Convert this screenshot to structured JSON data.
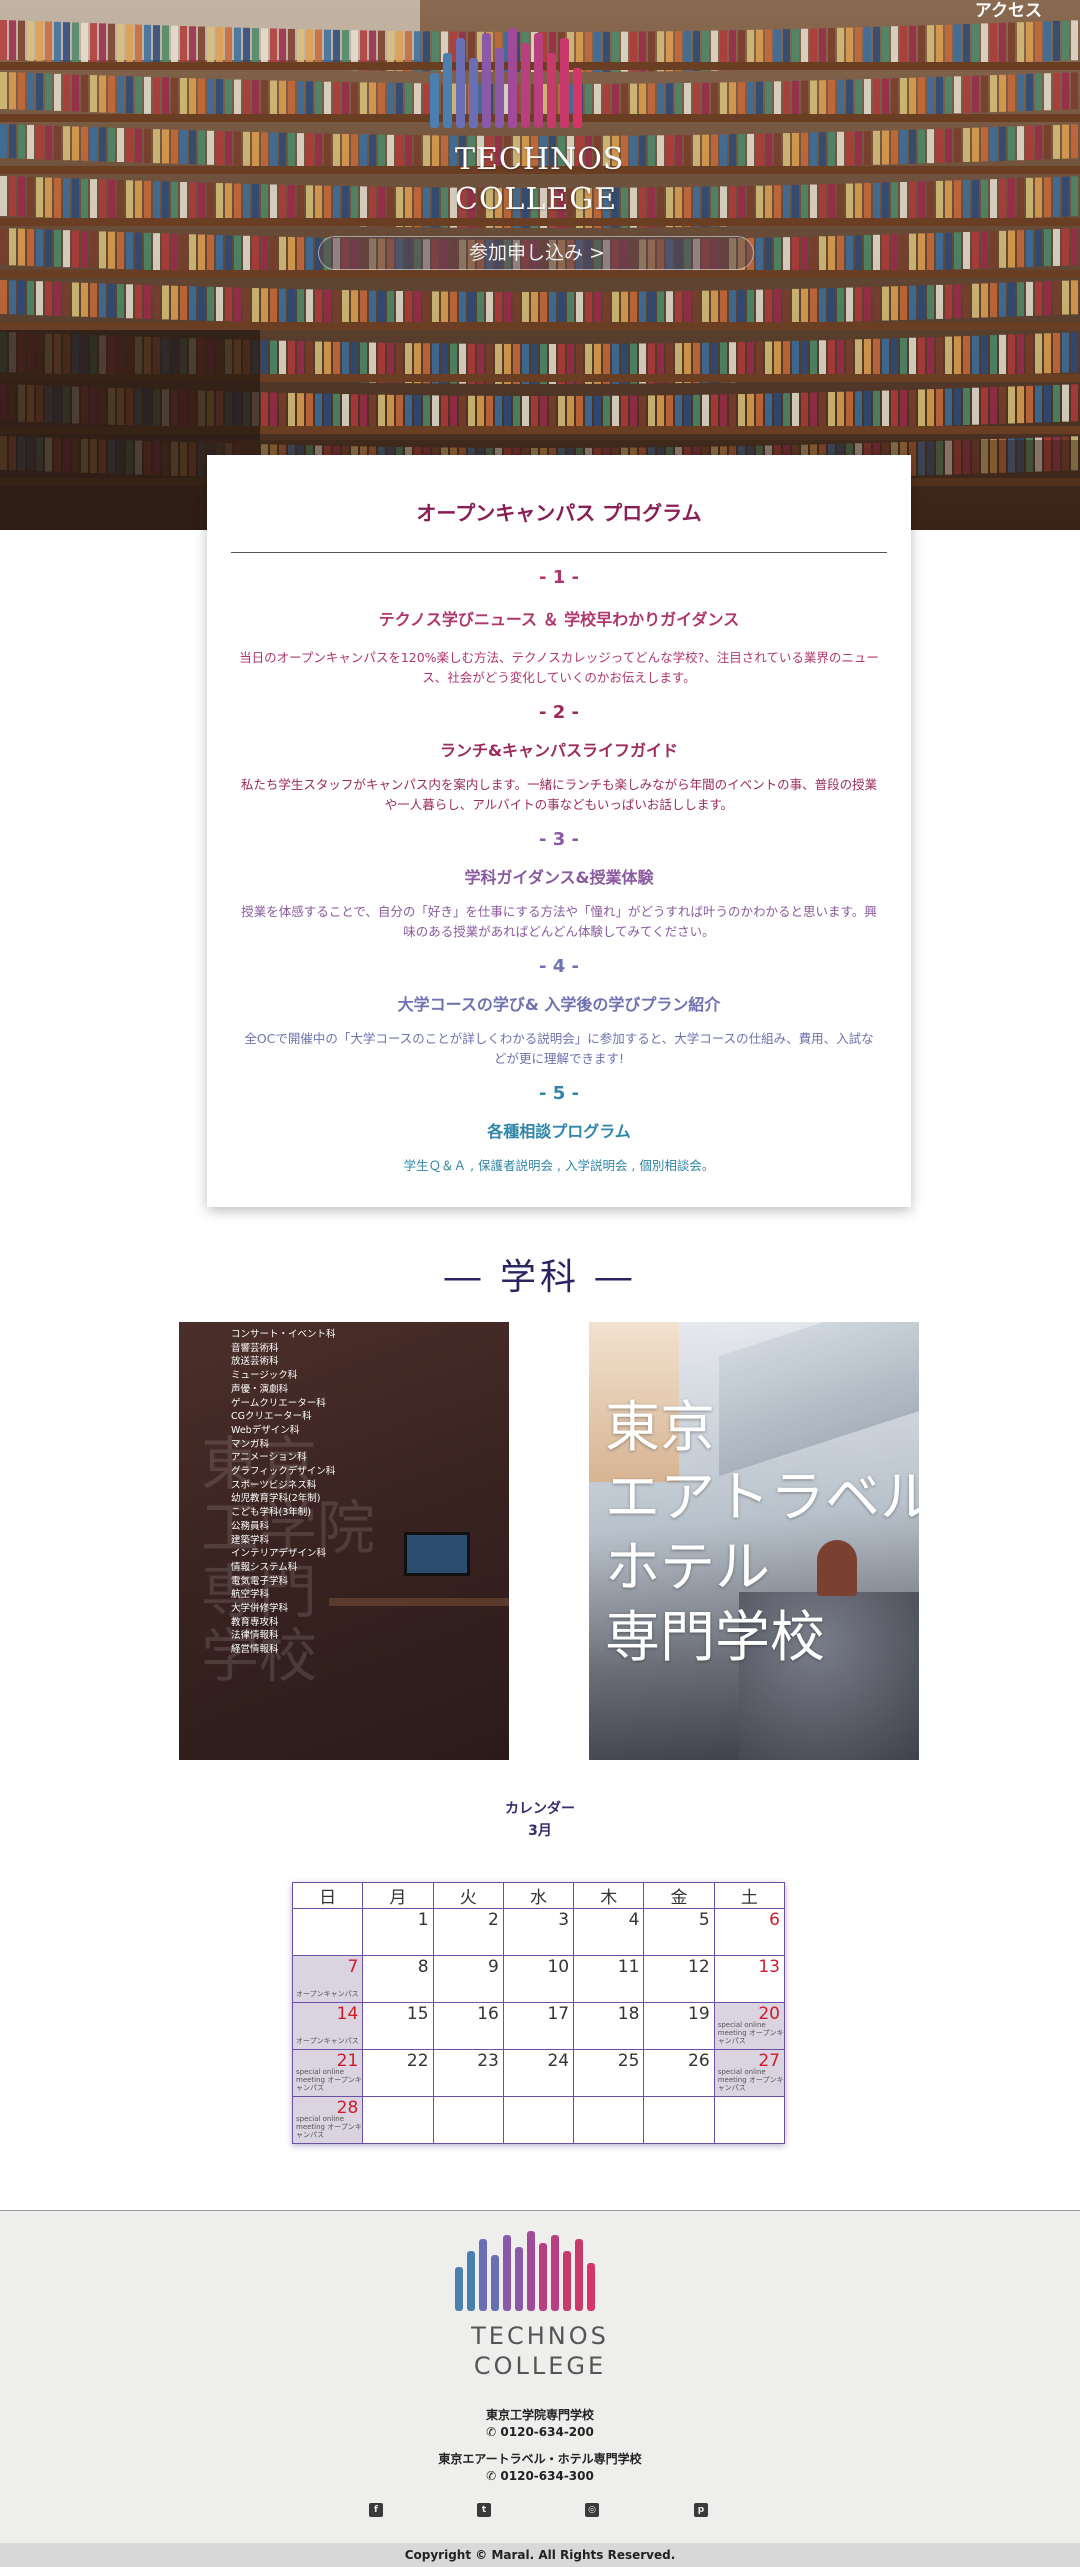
{
  "hero": {
    "access_label": "アクセス",
    "logo_title_line1": "TECHNOS",
    "logo_title_line2": "COLLEGE",
    "join_button": "参加申し込み >"
  },
  "program": {
    "title": "オープンキャンパス プログラム",
    "items": [
      {
        "num": "- 1 -",
        "title": "テクノス学びニュース ＆ 学校早わかりガイダンス",
        "text": "当日のオープンキャンパスを120%楽しむ方法、テクノスカレッジってどんな学校?、注目されている業界のニュース、社会がどう変化していくのかお伝えします。"
      },
      {
        "num": "- 2 -",
        "title": "ランチ&キャンパスライフガイド",
        "text": "私たち学生スタッフがキャンパス内を案内します。一緒にランチも楽しみながら年間のイベントの事、普段の授業や一人暮らし、アルバイトの事などもいっぱいお話しします。"
      },
      {
        "num": "- 3 -",
        "title": "学科ガイダンス&授業体験",
        "text": "授業を体感することで、自分の「好き」を仕事にする方法や「憧れ」がどうすれば叶うのかわかると思います。興味のある授業があればどんどん体験してみてください。"
      },
      {
        "num": "- 4 -",
        "title": "大学コースの学び& 入学後の学びプラン紹介",
        "text": "全OCで開催中の「大学コースのことが詳しくわかる説明会」に参加すると、大学コースの仕組み、費用、入試などが更に理解できます!"
      },
      {
        "num": "- 5 -",
        "title": "各種相談プログラム",
        "text": "学生Ｑ＆Ａ , 保護者説明会 , 入学説明会 , 個別相談会。"
      }
    ]
  },
  "departments": {
    "title": "― 学科 ―",
    "left_ghost": [
      "東京",
      "工学院",
      "専門",
      "学校"
    ],
    "left_list": [
      "コンサート・イベント科",
      "音響芸術科",
      "放送芸術科",
      "ミュージック科",
      "声優・演劇科",
      "ゲームクリエーター科",
      "CGクリエーター科",
      "Webデザイン科",
      "マンガ科",
      "アニメーション科",
      "グラフィックデザイン科",
      "スポーツビジネス科",
      "幼児教育学科(2年制)",
      "こども学科(3年制)",
      "公務員科",
      "建築学科",
      "インテリアデザイン科",
      "情報システム科",
      "電気電子学科",
      "航空学科",
      "大学併修学科",
      "教育専攻科",
      "法律情報科",
      "経営情報科"
    ],
    "right_name": [
      "東京",
      "エアトラベル",
      "ホテル",
      "専門学校"
    ]
  },
  "calendar": {
    "heading": "カレンダー",
    "month": "3月",
    "weekdays": [
      "日",
      "月",
      "火",
      "水",
      "木",
      "金",
      "土"
    ],
    "weeks": [
      [
        {
          "d": ""
        },
        {
          "d": "1"
        },
        {
          "d": "2"
        },
        {
          "d": "3"
        },
        {
          "d": "4"
        },
        {
          "d": "5"
        },
        {
          "d": "6"
        }
      ],
      [
        {
          "d": "7",
          "note": "オープンキャンパス"
        },
        {
          "d": "8"
        },
        {
          "d": "9"
        },
        {
          "d": "10"
        },
        {
          "d": "11"
        },
        {
          "d": "12"
        },
        {
          "d": "13"
        }
      ],
      [
        {
          "d": "14",
          "note": "オープンキャンパス"
        },
        {
          "d": "15"
        },
        {
          "d": "16"
        },
        {
          "d": "17"
        },
        {
          "d": "18"
        },
        {
          "d": "19"
        },
        {
          "d": "20",
          "note": "special online meeting オープンキャンパス"
        }
      ],
      [
        {
          "d": "21",
          "note": "special online meeting オープンキャンパス"
        },
        {
          "d": "22"
        },
        {
          "d": "23"
        },
        {
          "d": "24"
        },
        {
          "d": "25"
        },
        {
          "d": "26"
        },
        {
          "d": "27",
          "note": "special online meeting オープンキャンパス"
        }
      ],
      [
        {
          "d": "28",
          "note": "special online meeting オープンキャンパス"
        },
        {
          "d": ""
        },
        {
          "d": ""
        },
        {
          "d": ""
        },
        {
          "d": ""
        },
        {
          "d": ""
        },
        {
          "d": ""
        }
      ]
    ],
    "day_color": "#333333",
    "weekend_color": "#d11a2a",
    "event_bg": "#d9d4e0"
  },
  "footer": {
    "title_line1": "TECHNOS",
    "title_line2": "COLLEGE",
    "school1_name": "東京工学院専門学校",
    "school1_phone": "0120-634-200",
    "school2_name": "東京エアートラベル・ホテル専門学校",
    "school2_phone": "0120-634-300",
    "socials": [
      "facebook-icon",
      "twitter-icon",
      "instagram-icon",
      "pinterest-icon"
    ],
    "copyright": "Copyright © Maral. All Rights Reserved."
  },
  "brand_colors": [
    "#4a7fb0",
    "#6a6fb5",
    "#8a5aa8",
    "#a04a98",
    "#b8407e",
    "#c83a6c",
    "#d6356a"
  ]
}
